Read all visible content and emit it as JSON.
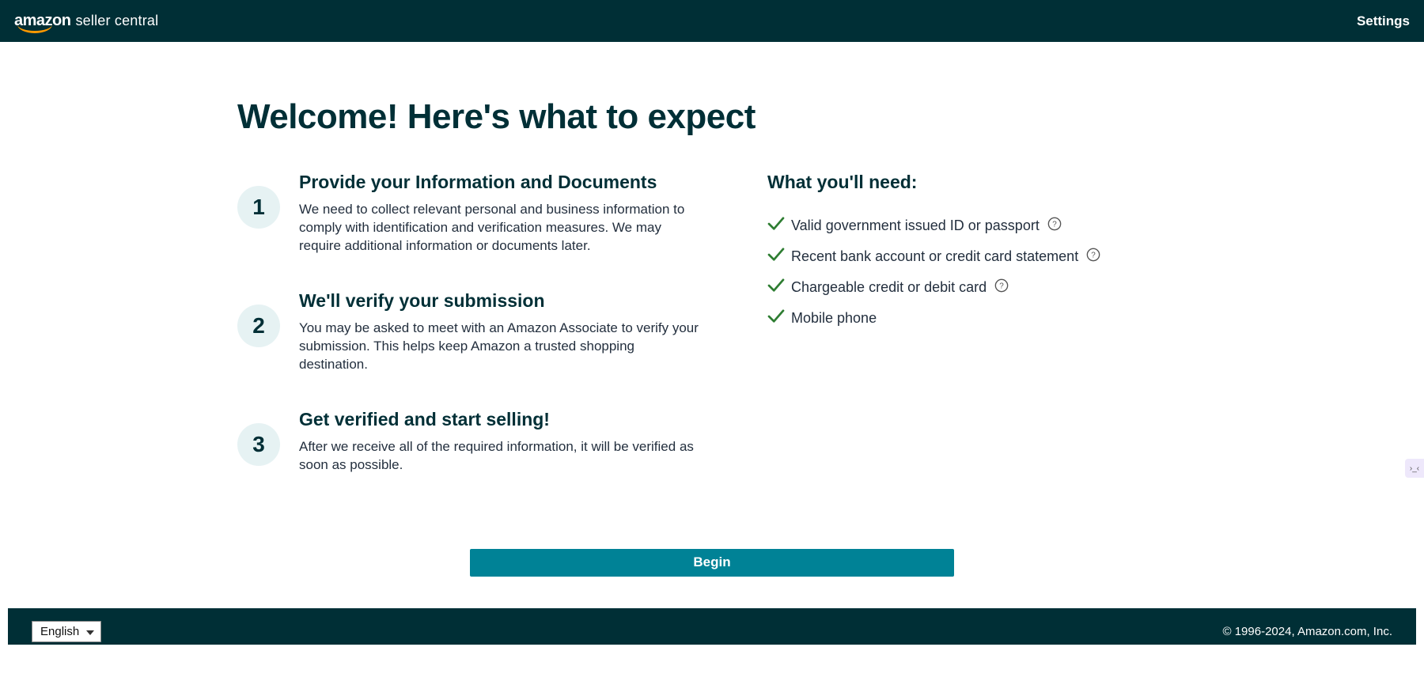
{
  "header": {
    "logo_brand": "amazon",
    "logo_product": "seller central",
    "settings_label": "Settings"
  },
  "main": {
    "title": "Welcome! Here's what to expect",
    "steps": [
      {
        "num": "1",
        "title": "Provide your Information and Documents",
        "desc": "We need to collect relevant personal and business information to comply with identification and verification measures. We may require additional information or documents later."
      },
      {
        "num": "2",
        "title": "We'll verify your submission",
        "desc": "You may be asked to meet with an Amazon Associate to verify your submission. This helps keep Amazon a trusted shopping destination."
      },
      {
        "num": "3",
        "title": "Get verified and start selling!",
        "desc": "After we receive all of the required information, it will be verified as soon as possible."
      }
    ],
    "needs_title": "What you'll need:",
    "needs": [
      {
        "label": "Valid government issued ID or passport",
        "help": true
      },
      {
        "label": "Recent bank account or credit card statement",
        "help": true
      },
      {
        "label": "Chargeable credit or debit card",
        "help": true
      },
      {
        "label": "Mobile phone",
        "help": false
      }
    ],
    "begin_label": "Begin"
  },
  "footer": {
    "language_selected": "English",
    "copyright": "© 1996-2024, Amazon.com, Inc."
  }
}
